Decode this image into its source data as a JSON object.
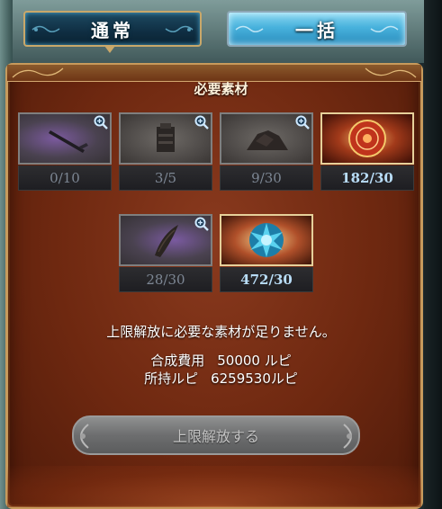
{
  "tabs": {
    "normal_label": "通常",
    "bulk_label": "一括"
  },
  "panel": {
    "title": "必要素材"
  },
  "materials": [
    {
      "count": "0/10",
      "icon": "dark-sword-icon",
      "sufficient": false
    },
    {
      "count": "3/5",
      "icon": "stone-block-icon",
      "sufficient": false
    },
    {
      "count": "9/30",
      "icon": "rock-pile-icon",
      "sufficient": false
    },
    {
      "count": "182/30",
      "icon": "red-orb-icon",
      "sufficient": true
    },
    {
      "count": "28/30",
      "icon": "dark-horn-icon",
      "sufficient": false
    },
    {
      "count": "472/30",
      "icon": "blue-crystal-icon",
      "sufficient": true
    }
  ],
  "message": {
    "warning": "上限解放に必要な素材が足りません。",
    "cost_label": "合成費用",
    "cost_value": "50000 ルピ",
    "owned_label": "所持ルピ",
    "owned_value": "6259530ルピ"
  },
  "action": {
    "uncap_label": "上限解放する",
    "enabled": false
  },
  "colors": {
    "panel": "#6e2810",
    "gold_border": "#c79a5c",
    "count_ok": "#b8dcf6",
    "count_insufficient": "#7d8794",
    "tab_active": "#48b2dd"
  }
}
